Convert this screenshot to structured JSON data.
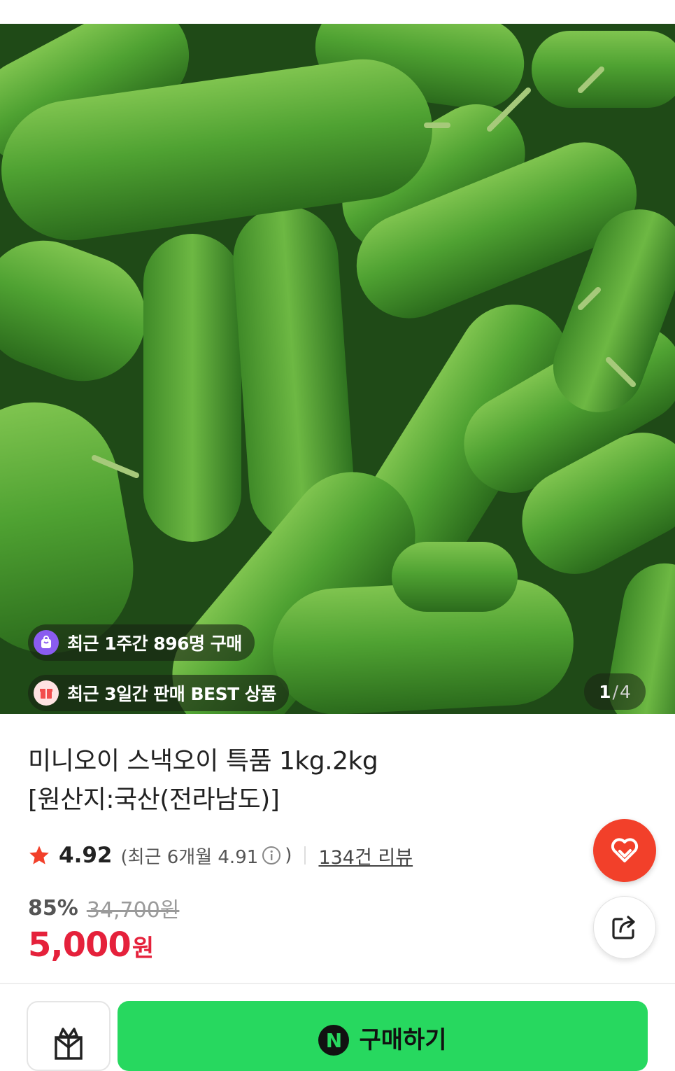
{
  "gallery": {
    "badges": [
      {
        "icon": "shopping-bag-icon",
        "text": "최근 1주간 896명 구매"
      },
      {
        "icon": "gift-box-icon",
        "text": "최근 3일간 판매 BEST 상품"
      }
    ],
    "counter": {
      "current": "1",
      "separator": "/",
      "total": "4"
    }
  },
  "product": {
    "title_line1": "미니오이 스낵오이 특품 1kg.2kg",
    "title_line2": "[원산지:국산(전라남도)]",
    "rating": "4.92",
    "recent_rating_prefix": "(최근 6개월 4.91",
    "recent_rating_suffix": ")",
    "review_count": "134건 리뷰",
    "discount": "85%",
    "original_price": "34,700원",
    "price": "5,000",
    "price_unit": "원"
  },
  "actions": {
    "like_icon": "heart-icon",
    "share_icon": "share-icon",
    "gift_icon": "gift-icon",
    "buy_logo": "N",
    "buy_label": "구매하기"
  },
  "colors": {
    "accent_red": "#e5213b",
    "like_orange": "#f2402a",
    "buy_green": "#27d85f"
  }
}
